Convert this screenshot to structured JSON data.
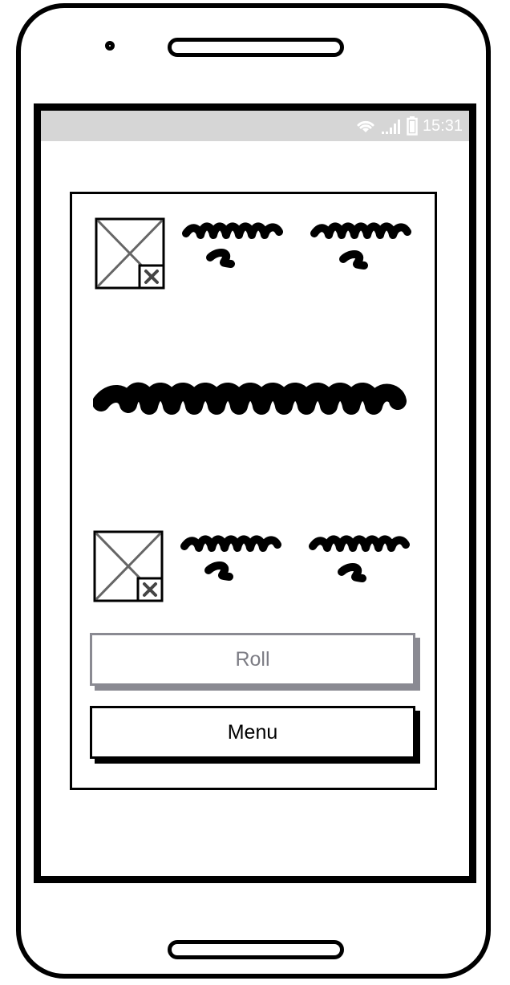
{
  "status_bar": {
    "time": "15:31",
    "icons": [
      "wifi-icon",
      "signal-icon",
      "battery-icon"
    ],
    "background_color": "#d6d6d6"
  },
  "card": {
    "top_row": {
      "image_icon": "image-placeholder-icon"
    },
    "bottom_row": {
      "image_icon": "image-placeholder-icon"
    }
  },
  "buttons": {
    "roll_label": "Roll",
    "menu_label": "Menu"
  },
  "colors": {
    "disabled_gray": "#8a8a92",
    "ink": "#000000"
  }
}
